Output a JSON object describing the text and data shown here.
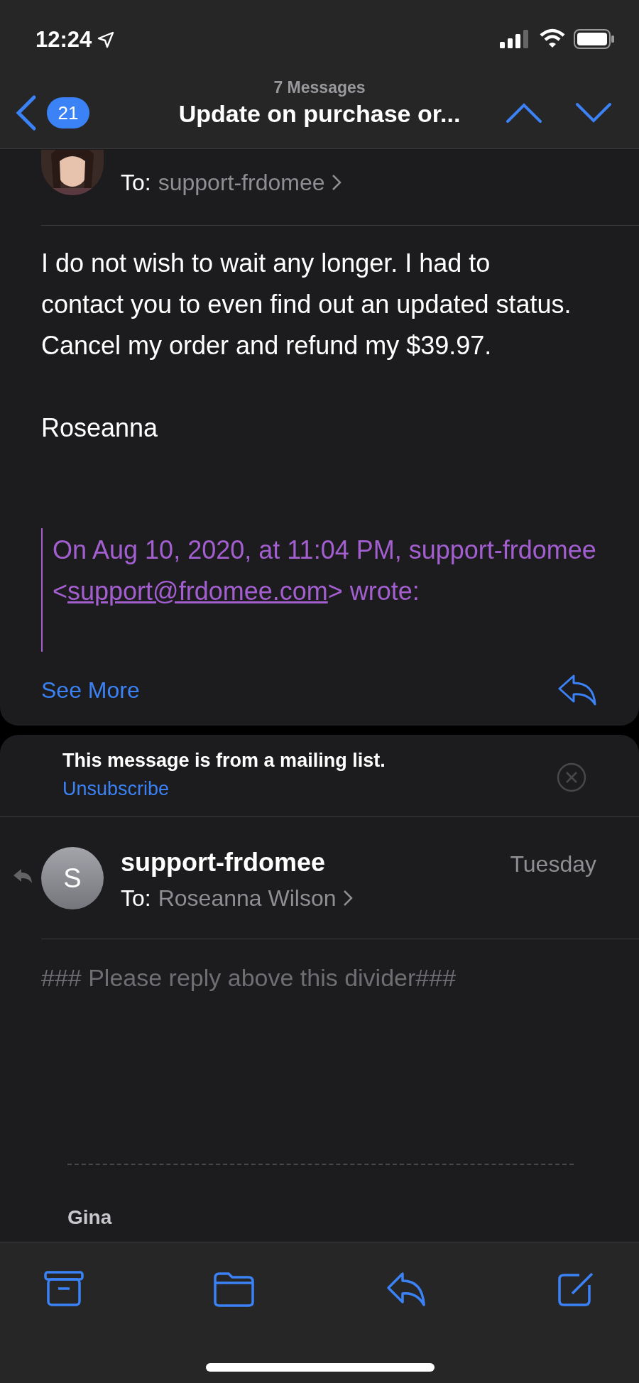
{
  "status_bar": {
    "time": "12:24"
  },
  "nav": {
    "back_count": "21",
    "subtitle": "7 Messages",
    "title": "Update on purchase or..."
  },
  "messages": [
    {
      "to_label": "To:",
      "to": "support-frdomee",
      "body": [
        "I do not wish to wait any longer. I had to contact you to even find out an updated status. Cancel my order and refund my $39.97.",
        "Roseanna"
      ],
      "quote": {
        "text": "On Aug 10, 2020, at 11:04 PM, support-frdomee <",
        "link": "support@frdomee.com",
        "after": "> wrote:"
      },
      "see_more": "See More"
    },
    {
      "banner": {
        "text": "This message is from a mailing list.",
        "link": "Unsubscribe"
      },
      "replied": true,
      "sender": "support-frdomee",
      "date": "Tuesday",
      "to_label": "To:",
      "to": "Roseanna Wilson",
      "avatar": {
        "kind": "initial",
        "initial": "S"
      },
      "body": [
        "### Please reply above this divider###"
      ],
      "signature": "Gina"
    }
  ]
}
